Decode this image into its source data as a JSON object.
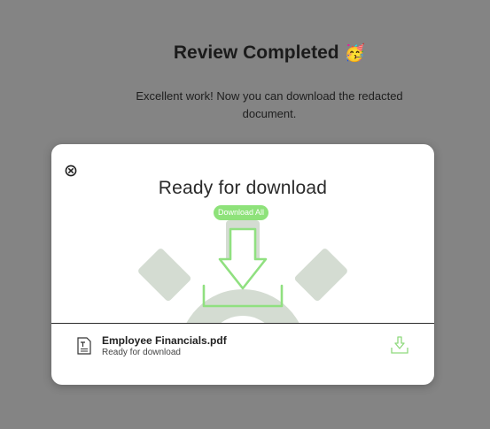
{
  "page": {
    "title": "Review Completed",
    "title_emoji": "🥳",
    "subtitle": "Excellent work! Now you can download the redacted document."
  },
  "modal": {
    "title": "Ready for download",
    "download_all_label": "Download All",
    "illustration_icons": [
      "gear-icon",
      "download-arrow-icon"
    ],
    "file": {
      "name": "Employee Financials.pdf",
      "status": "Ready for download",
      "icon": "document-icon",
      "download_icon": "download-icon"
    },
    "close_icon": "close-icon"
  },
  "colors": {
    "overlay": "#848484",
    "accent_green": "#8ee27a",
    "gear": "#d4dcd2",
    "modal_bg": "#ffffff"
  }
}
